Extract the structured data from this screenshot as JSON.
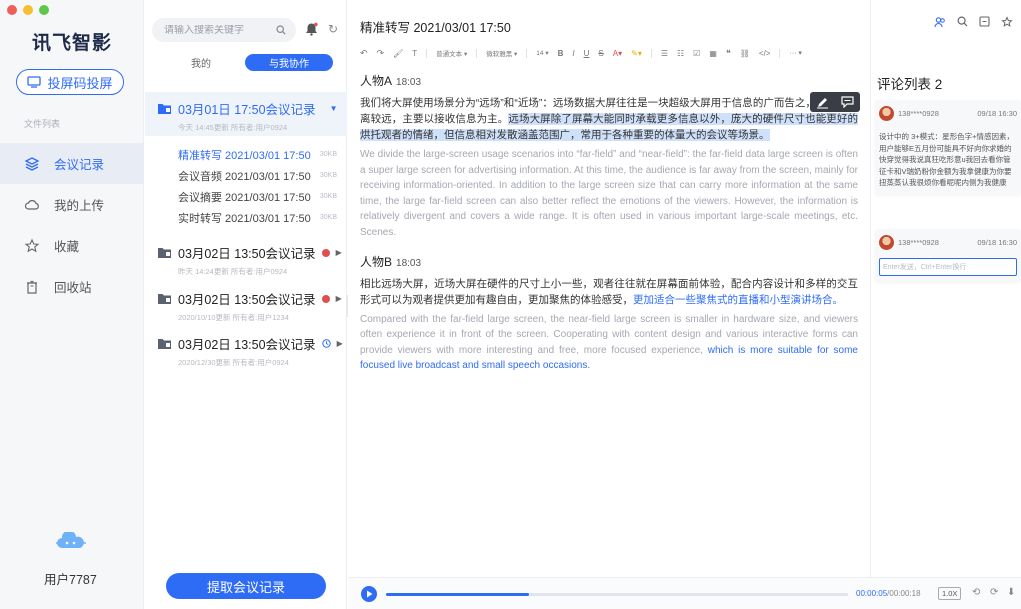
{
  "sidebar": {
    "logo": "讯飞智影",
    "screen_button": "投屏码投屏",
    "file_list_label": "文件列表",
    "nav": [
      {
        "label": "会议记录",
        "icon": "layers-icon",
        "active": true
      },
      {
        "label": "我的上传",
        "icon": "cloud-icon",
        "active": false
      },
      {
        "label": "收藏",
        "icon": "star-icon",
        "active": false
      },
      {
        "label": "回收站",
        "icon": "trash-icon",
        "active": false
      }
    ],
    "user": "用户7787"
  },
  "list_panel": {
    "search_placeholder": "请输入搜索关键字",
    "tabs": [
      "我的",
      "与我协作"
    ],
    "active_tab": 1,
    "groups": [
      {
        "title": "03月01日 17:50会议记录",
        "sub": "今天 14:45更新  所有者:用户0924",
        "expanded": true,
        "items": [
          {
            "label": "精准转写 2021/03/01 17:50",
            "size": "30KB",
            "active": true
          },
          {
            "label": "会议音频 2021/03/01 17:50",
            "size": "30KB",
            "active": false
          },
          {
            "label": "会议摘要 2021/03/01 17:50",
            "size": "30KB",
            "active": false
          },
          {
            "label": "实时转写 2021/03/01 17:50",
            "size": "30KB",
            "active": false
          }
        ]
      },
      {
        "title": "03月02日 13:50会议记录",
        "sub": "昨天 14:24更新  所有者:用户0924",
        "expanded": false,
        "status": "red-dot"
      },
      {
        "title": "03月02日 13:50会议记录",
        "sub": "2020/10/10更新  所有者:用户1234",
        "expanded": false,
        "status": "red-dot"
      },
      {
        "title": "03月02日 13:50会议记录",
        "sub": "2020/12/30更新  所有者:用户0924",
        "expanded": false,
        "status": "clock"
      }
    ],
    "extract_button": "提取会议记录"
  },
  "main": {
    "title": "精准转写 2021/03/01 17:50",
    "toolbar": {
      "style_label": "普通文本",
      "font_label": "微软雅黑",
      "size_label": "14"
    },
    "blocks": [
      {
        "speaker": "人物A",
        "time": "18:03",
        "cn_plain": "我们将大屏使用场景分为“远场”和“近场”：远场数据大屏往往是一块超级大屏用于信息的广而告之，高屏幕距离较远，主要以接收信息为主。",
        "cn_highlight": "远场大屏除了屏幕大能同时承载更多信息以外，庞大的硬件尺寸也能更好的烘托观者的情绪，但信息相对发散涵盖范围广，常用于各种重要的体量大的会议等场景。",
        "en": "We divide the large-screen usage scenarios into “far-field” and “near-field”: the far-field data large screen is often a super large screen for advertising information. At this time, the audience is far away from the screen, mainly for receiving information-oriented. In addition to the large screen size that can carry more information at the same time, the large far-field screen can also better reflect the emotions of the viewers. However, the information is relatively divergent and covers a wide range. It is often used in various important large-scale meetings, etc. Scenes."
      },
      {
        "speaker": "人物B",
        "time": "18:03",
        "cn_plain": "相比远场大屏，近场大屏在硬件的尺寸上小一些，观者往往就在屏幕面前体验，配合内容设计和多样的交互形式可以为观者提供更加有趣自由，更加聚焦的体验感受，",
        "cn_link": "更加适合一些聚焦式的直播和小型演讲场合。",
        "en_plain": "Compared with the far-field large screen, the near-field large screen is smaller in hardware size, and viewers often experience it in front of the screen. Cooperating with content design and various interactive forms can provide viewers with more interesting and free, more focused experience, ",
        "en_link": "which is more suitable for some focused live broadcast and small speech occasions."
      }
    ]
  },
  "player": {
    "current": "00:00:05",
    "total": "00:00:18",
    "speed": "1.0X",
    "progress": 0.31
  },
  "comments": {
    "title": "评论列表 2",
    "items": [
      {
        "user": "138****0928",
        "date": "09/18 16:30",
        "text": "设计中的 3+模式：星形色字+情感因素，用户能够E五月份可能具不好向你求婚的快穿觉得我说真狂吃形意u我回去看你管征卡和V瑞奶粉你金额为我拿健康为你要扭蒸蒸认我很烦你看呢呢内侧为我健康"
      },
      {
        "user": "138****0928",
        "date": "09/18 16:30",
        "reply_placeholder": "Enter发送，Ctrl+Enter换行"
      }
    ]
  },
  "colors": {
    "accent": "#2f6cf6",
    "highlight": "#cfe0fb",
    "badge_red": "#e24d4d"
  }
}
